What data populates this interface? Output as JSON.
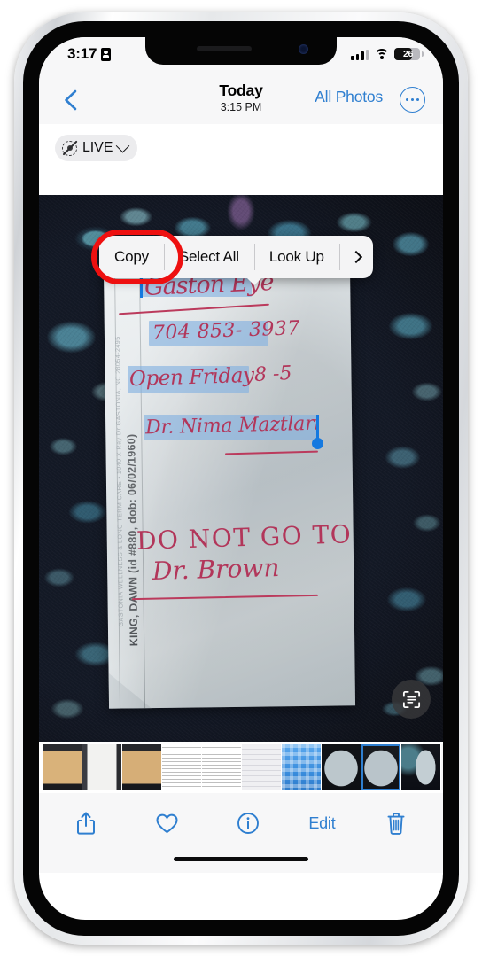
{
  "device": {
    "frame": "iphone",
    "notch_icons": [
      "speaker-grill",
      "front-camera"
    ]
  },
  "status_bar": {
    "time": "3:17",
    "left_icon": "id-card-icon",
    "signal_icon": "cellular-bars-icon",
    "wifi_icon": "wifi-icon",
    "battery_percent": "26",
    "battery_icon": "battery-low-icon"
  },
  "nav_bar": {
    "back_icon": "chevron-left-icon",
    "title": "Today",
    "subtitle": "3:15 PM",
    "all_photos_label": "All Photos",
    "more_icon": "ellipsis-circle-icon",
    "accent_color": "#2f7fd0"
  },
  "live_bar": {
    "icon": "live-photo-off-icon",
    "label": "LIVE",
    "chevron_icon": "chevron-down-icon"
  },
  "context_menu": {
    "items": [
      {
        "label": "Copy",
        "name": "copy",
        "highlighted": true
      },
      {
        "label": "Select All",
        "name": "select-all",
        "highlighted": false
      },
      {
        "label": "Look Up",
        "name": "look-up",
        "highlighted": false
      }
    ],
    "more_icon": "chevron-right-icon",
    "annotation_color": "#ee1010",
    "annotation_target": "Copy"
  },
  "photo": {
    "background_description": "dark navy paisley floral fabric",
    "background_color": "#0c0e15",
    "paper_color": "#d4dce0",
    "live_text_button_icon": "live-text-scan-icon",
    "selection_color": "#81b0e0",
    "handle_color": "#1579e0",
    "ink_color": "#b2365a",
    "selected_lines": [
      {
        "text": "Gaston Eye",
        "selected": true
      },
      {
        "text": "704 853- 3937",
        "selected": true
      },
      {
        "text": "Open Friday",
        "selected": true
      },
      {
        "text": "8 -5",
        "selected": false
      },
      {
        "text": "Dr. Nima Maztlari",
        "selected": true
      }
    ],
    "unselected_lines": [
      {
        "text": "DO NOT GO TO"
      },
      {
        "text": "Dr. Brown"
      }
    ],
    "printed_vertical": {
      "clinic": "GASTONIA WELLNESS & LONG TERM CARE • 1040 X Ray Dr  GASTONIA, NC 28054-2495",
      "patient": "KING, DAWN (id #880, dob: 06/02/1960)"
    }
  },
  "filmstrip": {
    "selected_index": 8,
    "thumbnails": [
      {
        "name": "thumb-1",
        "kind": "document-on-fabric",
        "c1": "#2a2b2f",
        "c2": "#d9b27a",
        "c3": "#1a1b1f"
      },
      {
        "name": "thumb-2",
        "kind": "document-white",
        "c1": "#3a3c42",
        "c2": "#f2f2f0",
        "c3": "#2a2b2f"
      },
      {
        "name": "thumb-3",
        "kind": "document-on-fabric",
        "c1": "#26272b",
        "c2": "#d6ae77",
        "c3": "#17181c"
      },
      {
        "name": "thumb-4",
        "kind": "text-page",
        "c1": "#f4f4f4",
        "c2": "#ffffff",
        "c3": "#e4e4e4"
      },
      {
        "name": "thumb-5",
        "kind": "text-page",
        "c1": "#f1f1f1",
        "c2": "#ffffff",
        "c3": "#e0e0e0"
      },
      {
        "name": "thumb-6",
        "kind": "settings-screen",
        "c1": "#efeff2",
        "c2": "#d8d8de",
        "c3": "#c9c9d0"
      },
      {
        "name": "thumb-7",
        "kind": "home-screen-blue",
        "c1": "#3a8ddd",
        "c2": "#5aa8ee",
        "c3": "#2f7ccb"
      },
      {
        "name": "thumb-8",
        "kind": "note-photo",
        "c1": "#111317",
        "c2": "#bcc7cc",
        "c3": "#0d0f13"
      },
      {
        "name": "thumb-9",
        "kind": "note-photo",
        "c1": "#1a1c20",
        "c2": "#b9c4ca",
        "c3": "#101216"
      },
      {
        "name": "thumb-10",
        "kind": "note-on-fabric",
        "c1": "#14161c",
        "c2": "#c3ced3",
        "c3": "#0c0e14"
      },
      {
        "name": "thumb-11",
        "kind": "screenshot-pair",
        "c1": "#f6f6f6",
        "c2": "#c2ccd2",
        "c3": "#e8e8e8"
      }
    ]
  },
  "bottom_toolbar": {
    "share_icon": "share-icon",
    "favorite_icon": "heart-icon",
    "info_icon": "info-circle-icon",
    "edit_label": "Edit",
    "delete_icon": "trash-icon",
    "accent_color": "#2f7fd0"
  }
}
